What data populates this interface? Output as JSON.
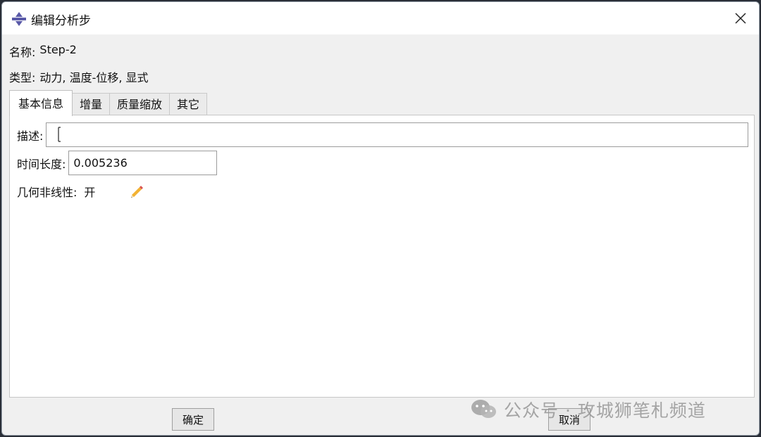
{
  "window": {
    "title": "编辑分析步",
    "close_glyph": "✕"
  },
  "info": {
    "name_label": "名称:",
    "name_value": "Step-2",
    "type_label": "类型:",
    "type_value": "动力, 温度-位移, 显式"
  },
  "tabs": [
    {
      "label": "基本信息",
      "active": true
    },
    {
      "label": "增量",
      "active": false
    },
    {
      "label": "质量缩放",
      "active": false
    },
    {
      "label": "其它",
      "active": false
    }
  ],
  "basic": {
    "description_label": "描述:",
    "description_value": "",
    "time_label": "时间长度:",
    "time_value": "0.005236",
    "nlgeom_label": "几何非线性:",
    "nlgeom_value": "开"
  },
  "buttons": {
    "ok": "确定",
    "cancel": "取消"
  },
  "watermark": {
    "text": "公众号 · 攻城狮笔札频道"
  },
  "icons": {
    "app": "abaqus-logo-icon",
    "close": "close-icon",
    "edit": "pencil-icon",
    "watermark": "wechat-icon"
  },
  "colors": {
    "title_bg": "#ffffff",
    "dialog_bg": "#f0f0f0",
    "panel_bg": "#ffffff",
    "app_icon": "#5a5aa8"
  }
}
